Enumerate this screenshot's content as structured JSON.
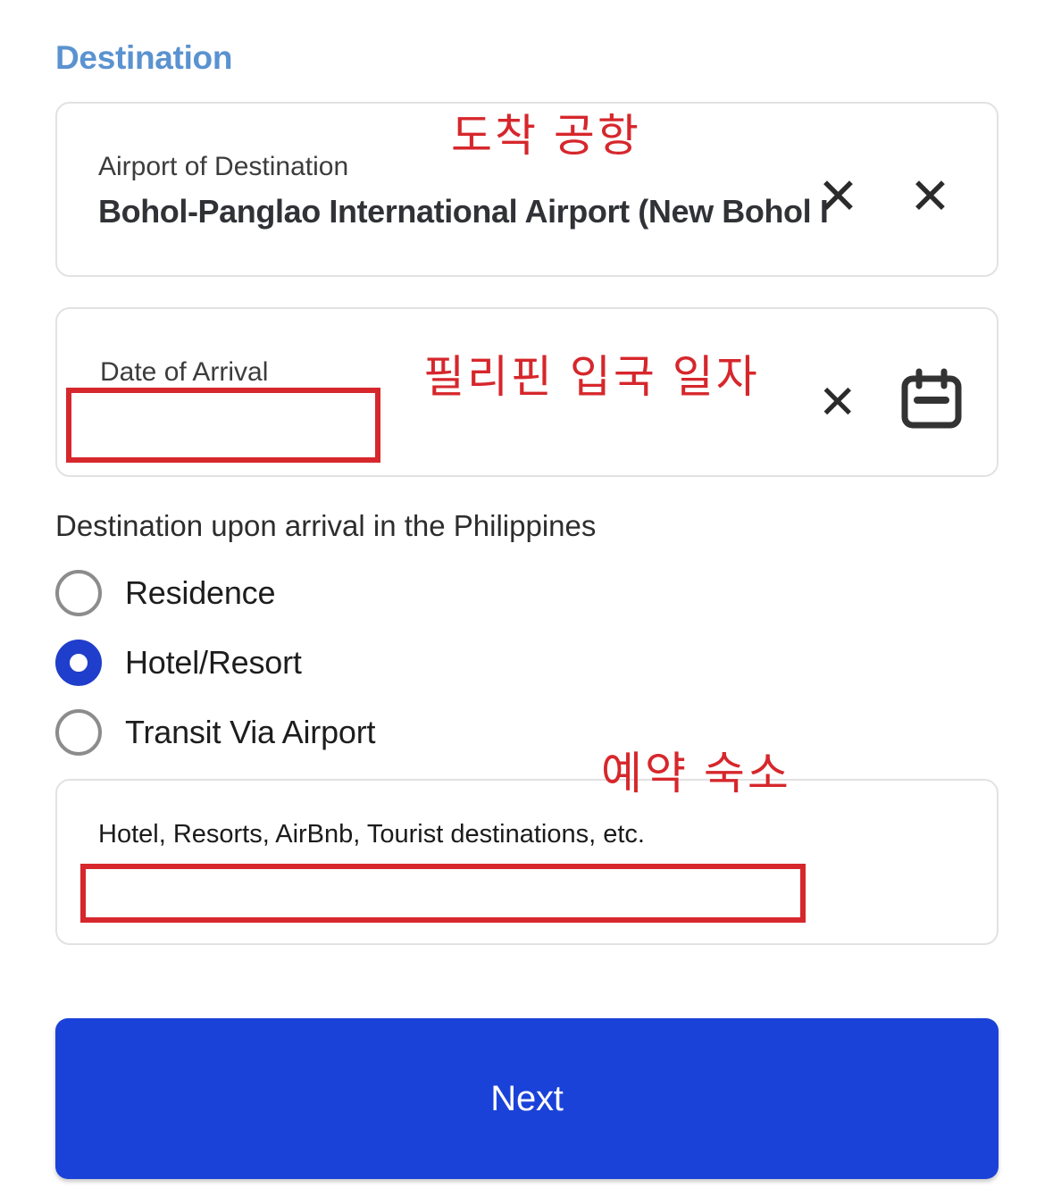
{
  "section": {
    "title": "Destination"
  },
  "fields": {
    "airport": {
      "label": "Airport of Destination",
      "value": "Bohol-Panglao International Airport (New Bohol I"
    },
    "date_of_arrival": {
      "label": "Date of Arrival",
      "value": "",
      "icon": "calendar-icon"
    },
    "accommodation": {
      "hint_line_1": "Hotel, Resorts, AirBnb, Tourist destinations, etc.",
      "hint_line_2": "",
      "value": ""
    }
  },
  "radio_group": {
    "label": "Destination upon arrival in the Philippines",
    "selected": "Hotel/Resort",
    "options": [
      {
        "label": "Residence",
        "selected": false
      },
      {
        "label": "Hotel/Resort",
        "selected": true
      },
      {
        "label": "Transit Via Airport",
        "selected": false
      }
    ]
  },
  "actions": {
    "next_label": "Next"
  },
  "annotations": {
    "airport_note": "도착 공항",
    "date_note": "필리핀 입국 일자",
    "hotel_note": "예약 숙소",
    "x_mark": "✕"
  },
  "colors": {
    "section_title": "#5b92d0",
    "annotation_red": "#d6272c",
    "primary_blue": "#1b42d8",
    "radio_selected": "#1f3ecb",
    "card_border": "#e2e2e2"
  }
}
